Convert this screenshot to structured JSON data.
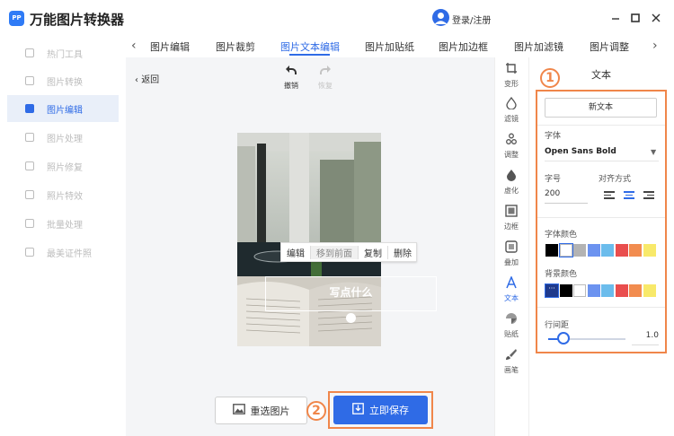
{
  "app": {
    "logo_text": "PP",
    "title": "万能图片转换器",
    "login_label": "登录/注册",
    "window_controls": [
      "minimize-icon",
      "maximize-icon",
      "close-icon"
    ]
  },
  "sidebar": {
    "items": [
      {
        "label": "热门工具",
        "icon": "hot-tools-icon",
        "active": false
      },
      {
        "label": "图片转换",
        "icon": "convert-icon",
        "active": false
      },
      {
        "label": "图片编辑",
        "icon": "edit-icon",
        "active": true
      },
      {
        "label": "图片处理",
        "icon": "process-icon",
        "active": false
      },
      {
        "label": "照片修复",
        "icon": "repair-icon",
        "active": false
      },
      {
        "label": "照片特效",
        "icon": "effects-icon",
        "active": false
      },
      {
        "label": "批量处理",
        "icon": "batch-icon",
        "active": false
      },
      {
        "label": "最美证件照",
        "icon": "id-photo-icon",
        "active": false
      }
    ]
  },
  "tabs": [
    {
      "label": "图片编辑",
      "active": false
    },
    {
      "label": "图片裁剪",
      "active": false
    },
    {
      "label": "图片文本编辑",
      "active": true
    },
    {
      "label": "图片加贴纸",
      "active": false
    },
    {
      "label": "图片加边框",
      "active": false
    },
    {
      "label": "图片加滤镜",
      "active": false
    },
    {
      "label": "图片调整",
      "active": false
    }
  ],
  "editor": {
    "back_label": "返回",
    "undo_label": "撤销",
    "redo_label": "恢复",
    "context_menu": [
      {
        "label": "编辑",
        "disabled": false
      },
      {
        "label": "移到前面",
        "disabled": true
      },
      {
        "label": "复制",
        "disabled": false
      },
      {
        "label": "删除",
        "disabled": false
      }
    ],
    "text_box_content": "写点什么",
    "reselect_label": "重选图片",
    "save_label": "立即保存",
    "badge_save": "2"
  },
  "tools": [
    {
      "label": "变形",
      "icon": "transform-icon",
      "active": false
    },
    {
      "label": "滤镜",
      "icon": "filter-icon",
      "active": false
    },
    {
      "label": "调整",
      "icon": "adjust-icon",
      "active": false
    },
    {
      "label": "虚化",
      "icon": "blur-icon",
      "active": false
    },
    {
      "label": "边框",
      "icon": "border-icon",
      "active": false
    },
    {
      "label": "叠加",
      "icon": "overlay-icon",
      "active": false
    },
    {
      "label": "文本",
      "icon": "text-icon",
      "active": true
    },
    {
      "label": "贴纸",
      "icon": "sticker-icon",
      "active": false
    },
    {
      "label": "画笔",
      "icon": "brush-icon",
      "active": false
    }
  ],
  "panel": {
    "title": "文本",
    "badge": "1",
    "new_text_label": "新文本",
    "font_label": "字体",
    "font_value": "Open Sans Bold",
    "size_label": "字号",
    "size_value": "200",
    "align_label": "对齐方式",
    "align_options": [
      "left",
      "center",
      "right"
    ],
    "align_selected": "center",
    "font_color_label": "字体颜色",
    "font_colors": [
      "#000000",
      "#ffffff",
      "#b3b3b3",
      "#6c93f0",
      "#6bbcec",
      "#e94e4e",
      "#f28c4f",
      "#f8e96a"
    ],
    "font_color_selected": 1,
    "bg_color_label": "背景颜色",
    "bg_colors": [
      "#1f3a8c",
      "#000000",
      "#ffffff",
      "#6c93f0",
      "#6bbcec",
      "#e94e4e",
      "#f28c4f",
      "#f8e96a"
    ],
    "bg_color_selected": 0,
    "line_spacing_label": "行间距",
    "line_spacing_value": "1.0",
    "line_spacing_fraction": 0.2
  },
  "colors": {
    "accent": "#2f6be6",
    "highlight": "#f0864a"
  }
}
